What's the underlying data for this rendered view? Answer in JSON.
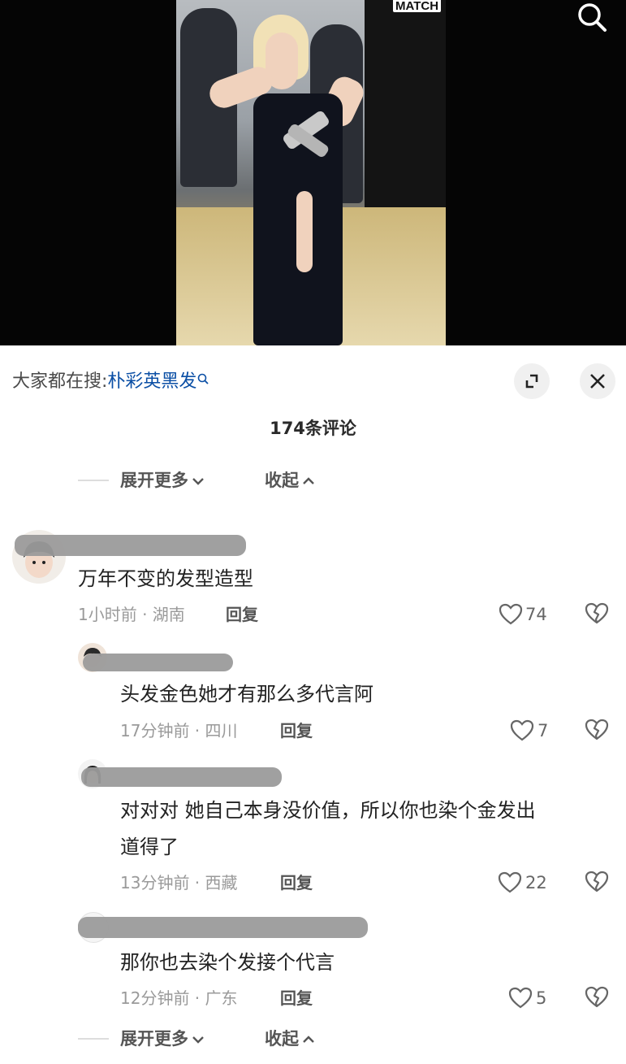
{
  "video": {
    "logo_text": "MATCH"
  },
  "trending": {
    "prefix": "大家都在搜:",
    "keyword": "朴彩英黑发"
  },
  "comment_count": "174条评论",
  "expand_more": "展开更多",
  "collapse": "收起",
  "comments": [
    {
      "text": "万年不变的发型造型",
      "time": "1小时前 · 湖南",
      "reply_label": "回复",
      "likes": "74"
    }
  ],
  "replies": [
    {
      "text": "头发金色她才有那么多代言阿",
      "time": "17分钟前 · 四川",
      "reply_label": "回复",
      "likes": "7"
    },
    {
      "text_line1": "对对对 她自己本身没价值，所以你也染个金发出",
      "text_line2": "道得了",
      "time": "13分钟前 · 西藏",
      "reply_label": "回复",
      "likes": "22"
    },
    {
      "text": "那你也去染个发接个代言",
      "time": "12分钟前 · 广东",
      "reply_label": "回复",
      "likes": "5"
    }
  ],
  "footer": {
    "expand_more": "展开更多",
    "collapse": "收起"
  },
  "colors": {
    "keyword": "#0b4fa5",
    "meta": "#9a9a9a",
    "background": "#ffffff"
  }
}
